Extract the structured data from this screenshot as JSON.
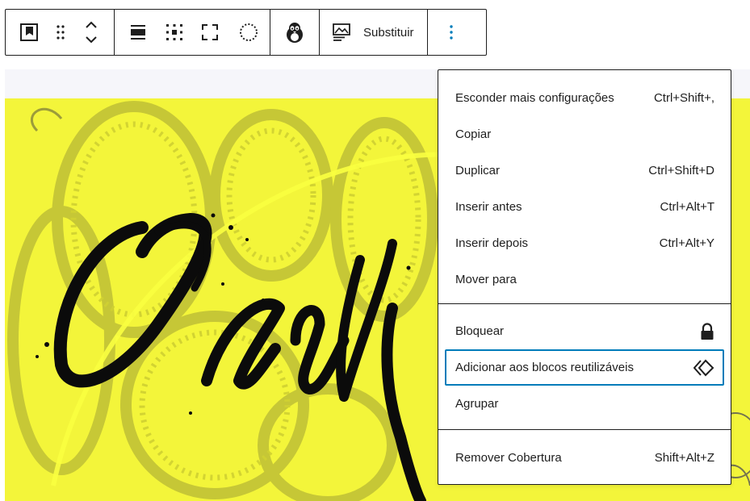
{
  "toolbar": {
    "replace_label": "Substituir",
    "buttons": {
      "block_type": "cover-block-icon",
      "drag": "drag-handle-icon",
      "move": "move-up-down-icon",
      "align": "align-icon",
      "content_position": "content-position-icon",
      "full_height": "fullscreen-icon",
      "duotone": "duotone-circle-icon",
      "avatar": "avatar-icon",
      "more": "more-vertical-icon"
    }
  },
  "menu": {
    "group1": [
      {
        "label": "Esconder mais configurações",
        "shortcut": "Ctrl+Shift+,"
      },
      {
        "label": "Copiar",
        "shortcut": ""
      },
      {
        "label": "Duplicar",
        "shortcut": "Ctrl+Shift+D"
      },
      {
        "label": "Inserir antes",
        "shortcut": "Ctrl+Alt+T"
      },
      {
        "label": "Inserir depois",
        "shortcut": "Ctrl+Alt+Y"
      },
      {
        "label": "Mover para",
        "shortcut": ""
      }
    ],
    "group2": [
      {
        "label": "Bloquear",
        "icon": "lock-icon"
      },
      {
        "label": "Adicionar aos blocos reutilizáveis",
        "icon": "reusable-block-icon"
      },
      {
        "label": "Agrupar"
      }
    ],
    "group3": [
      {
        "label": "Remover Cobertura",
        "shortcut": "Shift+Alt+Z"
      }
    ]
  },
  "colors": {
    "cover_background": "#f3f53a",
    "focus_ring": "#007cba",
    "text": "#1e1e1e"
  }
}
